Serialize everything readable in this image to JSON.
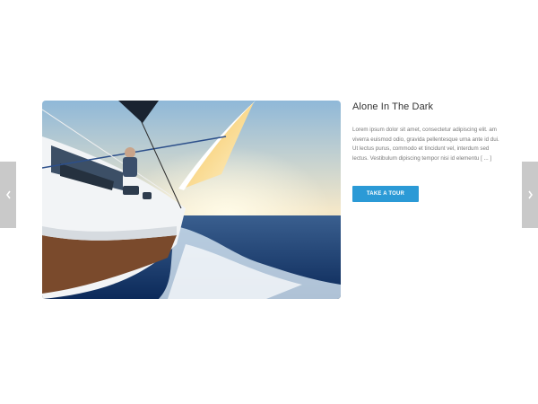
{
  "nav": {
    "prev_icon": "chevron-left-icon",
    "next_icon": "chevron-right-icon"
  },
  "slide": {
    "image_subject": "sailboat-on-sea",
    "title": "Alone In The Dark",
    "description": "Lorem ipsum dolor sit amet, consectetur adipiscing elit. am viverra euismod odio, gravida pellentesque urna ante id dui. Ut lectus purus, commodo et tincidunt vel, interdum sed lectus. Vestibulum dipiscing tempor nisi id elementu [ ... ]",
    "button_label": "TAKE A TOUR"
  },
  "colors": {
    "accent": "#2b9ad6",
    "arrow_bg": "#c9c9c9"
  }
}
